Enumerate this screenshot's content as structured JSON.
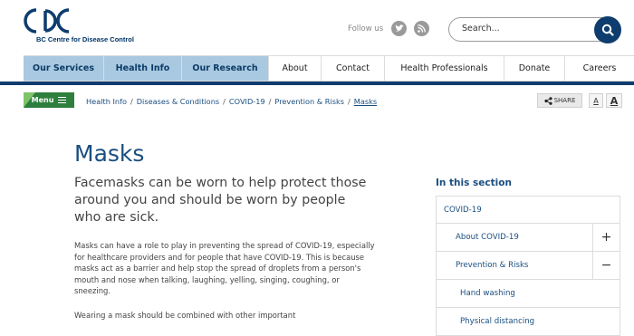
{
  "brand": {
    "mark": "CDC",
    "name": "BC Centre for Disease Control",
    "color": "#0e3c6e"
  },
  "follow": {
    "label": "Follow us",
    "icons": [
      "twitter-icon",
      "rss-icon"
    ]
  },
  "search": {
    "placeholder": "Search..."
  },
  "nav": {
    "items": [
      {
        "label": "Our Services",
        "highlighted": true
      },
      {
        "label": "Health Info",
        "highlighted": true
      },
      {
        "label": "Our Research",
        "highlighted": true
      },
      {
        "label": "About",
        "highlighted": false
      },
      {
        "label": "Contact",
        "highlighted": false
      },
      {
        "label": "Health Professionals",
        "highlighted": false
      },
      {
        "label": "Donate",
        "highlighted": false
      },
      {
        "label": "Careers",
        "highlighted": false
      }
    ]
  },
  "menu": {
    "label": "Menu"
  },
  "breadcrumb": {
    "items": [
      "Health Info",
      "Diseases & Conditions",
      "COVID-19",
      "Prevention & Risks",
      "Masks"
    ],
    "separator": "/"
  },
  "tools": {
    "share": "SHARE",
    "font_small": "A",
    "font_large": "A"
  },
  "page": {
    "title": "Masks",
    "lead": "Facemasks can be worn to help protect those around you and should be worn by people who are sick.",
    "paragraphs": [
      "Masks can have a role to play in preventing the spread of COVID-19, especially for healthcare providers and for people that have COVID-19. This is because masks act as a barrier and help stop the spread of droplets from a person's mouth and nose when talking, laughing, yelling, singing, coughing, or sneezing.",
      "Wearing a mask should be combined with other important"
    ]
  },
  "sidebar": {
    "heading": "In this section",
    "items": [
      {
        "label": "COVID-19",
        "toggle": ""
      },
      {
        "label": "About COVID-19",
        "toggle": "+"
      },
      {
        "label": "Prevention & Risks",
        "toggle": "−"
      },
      {
        "label": "Hand washing",
        "toggle": ""
      },
      {
        "label": "Physical distancing",
        "toggle": ""
      }
    ]
  }
}
